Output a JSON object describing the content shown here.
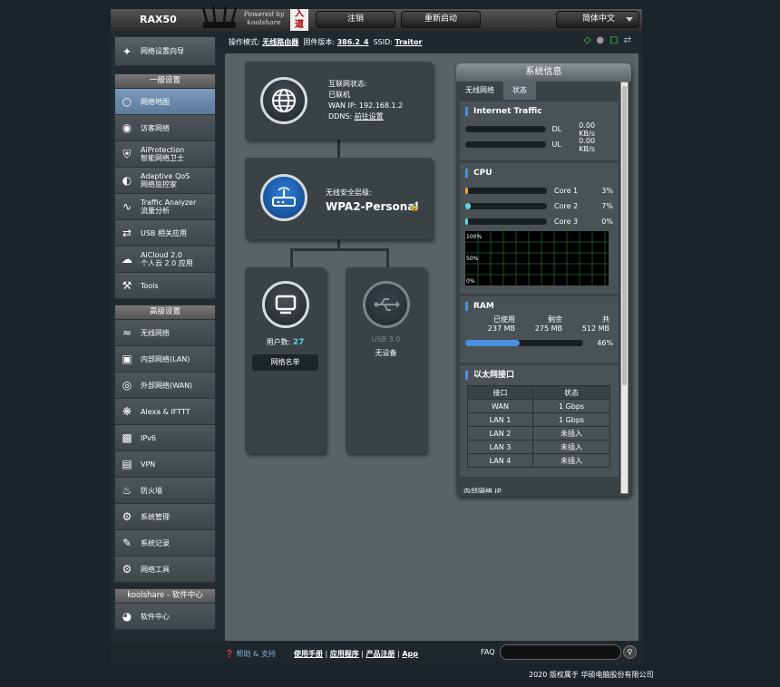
{
  "header": {
    "model": "RAX50",
    "powered_line1": "Powered by",
    "powered_line2": "koolshare",
    "logo_text": "入道",
    "logout_label": "注销",
    "reboot_label": "重新启动",
    "language": "简体中文"
  },
  "statusline": {
    "mode_label": "操作模式:",
    "mode_value": "无线路由器",
    "fw_label": "固件版本:",
    "fw_value": "386.2_4",
    "ssid_label": "SSID:",
    "ssid_value": "Traitor"
  },
  "sidebar": {
    "guide_label": "网络设置向导",
    "general_title": "一般设置",
    "general_items": [
      {
        "label": "网络地图",
        "icon": "network-map-icon"
      },
      {
        "label": "访客网络",
        "icon": "guest-network-icon"
      },
      {
        "label": "AiProtection\n智能网络卫士",
        "icon": "aiprotection-icon"
      },
      {
        "label": "Adaptive QoS\n网络监控家",
        "icon": "qos-gauge-icon"
      },
      {
        "label": "Traffic Analyzer\n流量分析",
        "icon": "traffic-analyzer-icon"
      },
      {
        "label": "USB 相关应用",
        "icon": "usb-icon"
      },
      {
        "label": "AiCloud 2.0\n个人云 2.0 应用",
        "icon": "cloud-icon"
      },
      {
        "label": "Tools",
        "icon": "wrench-icon"
      }
    ],
    "advanced_title": "高级设置",
    "advanced_items": [
      {
        "label": "无线网络",
        "icon": "wireless-icon"
      },
      {
        "label": "内部网络(LAN)",
        "icon": "lan-icon"
      },
      {
        "label": "外部网络(WAN)",
        "icon": "wan-globe-icon"
      },
      {
        "label": "Alexa & IFTTT",
        "icon": "alexa-icon"
      },
      {
        "label": "IPv6",
        "icon": "ipv6-icon"
      },
      {
        "label": "VPN",
        "icon": "vpn-icon"
      },
      {
        "label": "防火墙",
        "icon": "firewall-icon"
      },
      {
        "label": "系统管理",
        "icon": "admin-gear-icon"
      },
      {
        "label": "系统记录",
        "icon": "log-icon"
      },
      {
        "label": "网络工具",
        "icon": "network-tools-icon"
      }
    ],
    "soft_title": "koolshare - 软件中心",
    "soft_item": "软件中心"
  },
  "map": {
    "internet_status_label": "互联网状态:",
    "internet_status": "已联机",
    "wan_ip_label": "WAN IP:",
    "wan_ip": "192.168.1.2",
    "ddns_label": "DDNS:",
    "ddns_value": "前往设置",
    "security_label": "无线安全层级:",
    "security_value": "WPA2-Personal",
    "clients_label": "用户数:",
    "clients_count": "27",
    "client_list_button": "网络名单",
    "usb_label": "USB 3.0",
    "usb_status": "无设备"
  },
  "sysinfo": {
    "title": "系统信息",
    "tab_wireless": "无线网络",
    "tab_status": "状态",
    "traffic_title": "Internet Traffic",
    "dl_label": "DL",
    "dl_value": "0.00 KB/s",
    "ul_label": "UL",
    "ul_value": "0.00 KB/s",
    "cpu_title": "CPU",
    "cores": [
      {
        "label": "Core 1",
        "value": "3%",
        "pct": 3,
        "color": "#e8a33a"
      },
      {
        "label": "Core 2",
        "value": "7%",
        "pct": 7,
        "color": "#5ed6e0"
      },
      {
        "label": "Core 3",
        "value": "0%",
        "pct": 0,
        "color": "#5ed6e0"
      }
    ],
    "graph_labels": [
      "100%",
      "50%",
      "0%"
    ],
    "ram_title": "RAM",
    "ram_used_label": "已使用",
    "ram_free_label": "剩余",
    "ram_total_label": "共",
    "ram_used": "237 MB",
    "ram_free": "275 MB",
    "ram_total": "512 MB",
    "ram_pct_label": "46%",
    "ram_pct": 46,
    "eth_title": "以太网接口",
    "eth_col_port": "接口",
    "eth_col_status": "状态",
    "eth_rows": [
      {
        "port": "WAN",
        "status": "1 Gbps"
      },
      {
        "port": "LAN 1",
        "status": "1 Gbps"
      },
      {
        "port": "LAN 2",
        "status": "未插入"
      },
      {
        "port": "LAN 3",
        "status": "未插入"
      },
      {
        "port": "LAN 4",
        "status": "未插入"
      }
    ],
    "lan_ip_label": "内部网络 IP"
  },
  "footer": {
    "help": "帮助 & 支持",
    "manual": "使用手册",
    "utility": "应用程序",
    "register": "产品注册",
    "app": "App",
    "faq": "FAQ",
    "copyright": "2020 版权属于 华硕电脑股份有限公司"
  }
}
